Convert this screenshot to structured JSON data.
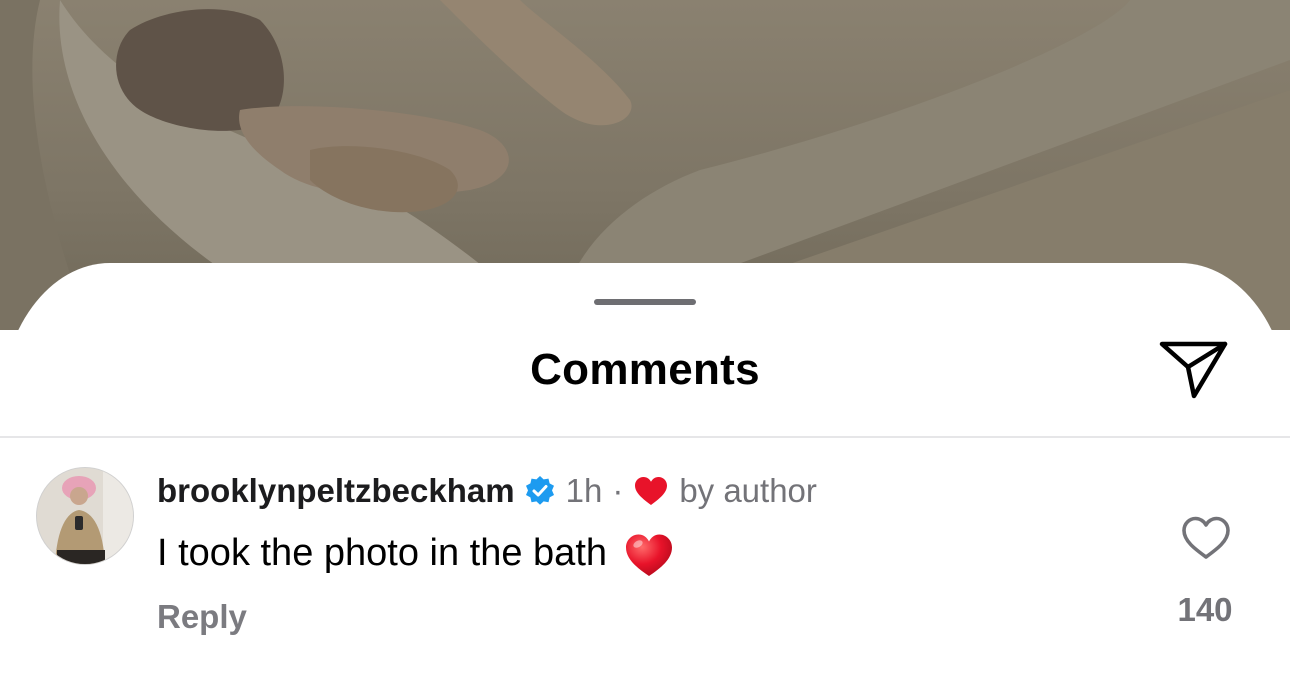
{
  "sheet": {
    "title": "Comments",
    "share_icon": "paper-plane-icon"
  },
  "comment": {
    "username": "brooklynpeltzbeckham",
    "verified_icon": "verified-badge-icon",
    "time": "1h",
    "separator": "·",
    "liked_by_author_icon": "heart-icon",
    "liked_by_author_label": "by author",
    "text": "I took the photo in the bath",
    "emoji": "red-heart-icon",
    "reply_label": "Reply",
    "like_icon": "heart-outline-icon",
    "like_count": "140"
  },
  "colors": {
    "verified": "#1d9bf0",
    "heart": "#e8132a",
    "secondary_text": "#737378",
    "divider": "#e6e6e8"
  }
}
